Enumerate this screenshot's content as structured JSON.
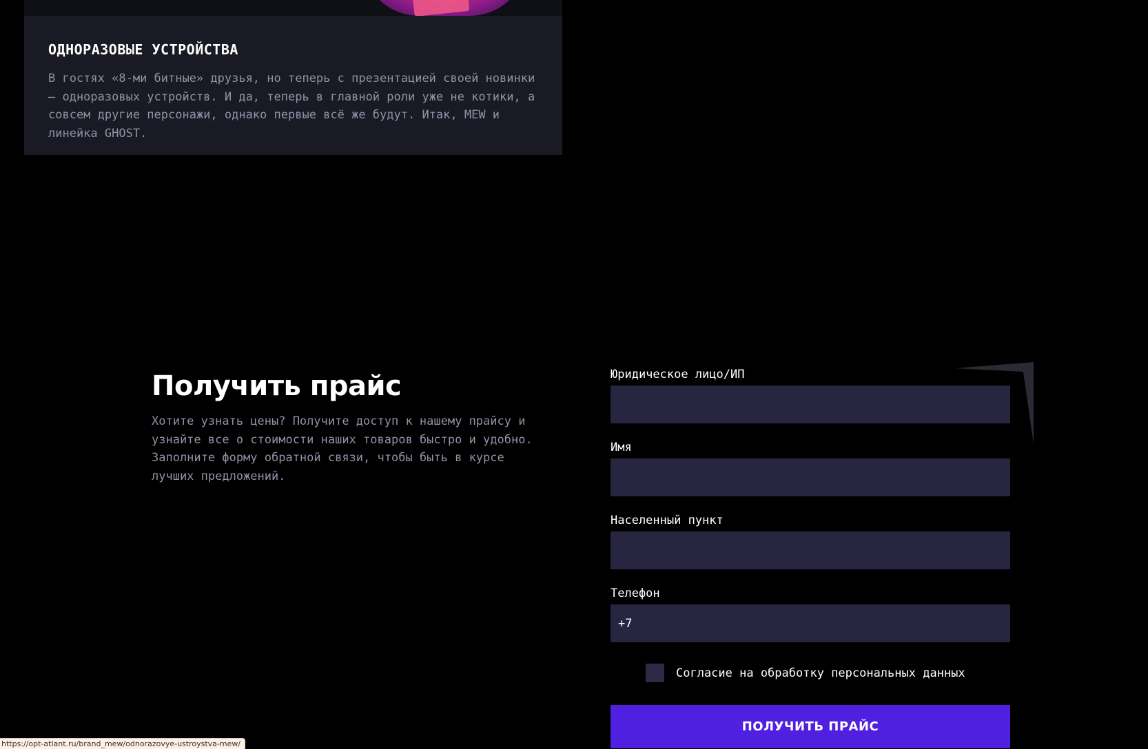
{
  "card": {
    "title": "ОДНОРАЗОВЫЕ УСТРОЙСТВА",
    "text": "В гостях «8-ми битные» друзья, но теперь с презентацией своей новинки — одноразовых устройств. И да, теперь в главной роли уже не котики, а совсем другие персонажи, однако первые всё же будут. Итак, MEW и линейка GHOST."
  },
  "price": {
    "heading": "Получить прайс",
    "description": "Хотите узнать цены? Получите доступ к нашему прайсу и узнайте все о стоимости наших товаров быстро и удобно. Заполните форму обратной связи, чтобы быть в курсе лучших предложений."
  },
  "form": {
    "fields": [
      {
        "label": "Юридическое лицо/ИП",
        "value": ""
      },
      {
        "label": "Имя",
        "value": ""
      },
      {
        "label": "Населенный пункт",
        "value": ""
      },
      {
        "label": "Телефон",
        "value": "+7"
      }
    ],
    "consent_label": "Согласие на обработку персональных данных",
    "submit_label": "ПОЛУЧИТЬ ПРАЙС"
  },
  "status_bar": {
    "url": "https://opt-atlant.ru/brand_mew/odnorazovye-ustroystva-mew/"
  },
  "colors": {
    "accent": "#5020e0",
    "input_bg": "#272540",
    "card_bg": "#1a1a24",
    "muted_text": "#8f93a6"
  }
}
